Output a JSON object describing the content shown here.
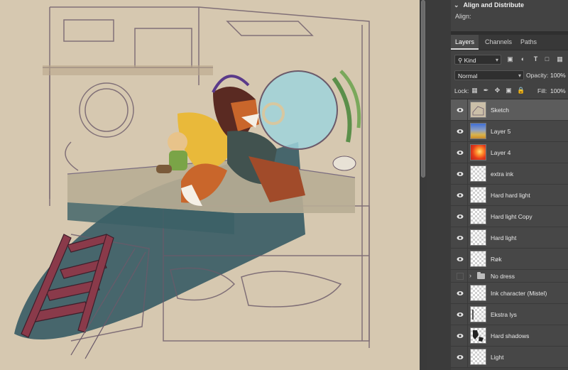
{
  "align_panel": {
    "title": "Align and Distribute",
    "align_label": "Align:"
  },
  "tabs": [
    {
      "label": "Layers",
      "active": true
    },
    {
      "label": "Channels",
      "active": false
    },
    {
      "label": "Paths",
      "active": false
    }
  ],
  "filter": {
    "kind_label": "Kind",
    "icons": [
      "image-filter-icon",
      "adjustment-filter-icon",
      "type-filter-icon",
      "shape-filter-icon",
      "smart-object-filter-icon"
    ]
  },
  "blend": {
    "mode": "Normal",
    "opacity_label": "Opacity:",
    "opacity_value": "100%"
  },
  "lock": {
    "label": "Lock:",
    "icons": [
      "lock-transparent-pixels-icon",
      "lock-image-pixels-icon",
      "lock-position-icon",
      "lock-artboard-icon",
      "lock-all-icon"
    ],
    "fill_label": "Fill:",
    "fill_value": "100%"
  },
  "layers": [
    {
      "name": "Sketch",
      "visible": true,
      "selected": true,
      "thumb": "sketch"
    },
    {
      "name": "Layer 5",
      "visible": true,
      "selected": false,
      "thumb": "layer5"
    },
    {
      "name": "Layer 4",
      "visible": true,
      "selected": false,
      "thumb": "layer4"
    },
    {
      "name": "extra ink",
      "visible": true,
      "selected": false,
      "thumb": "transparent"
    },
    {
      "name": "Hard hard light",
      "visible": true,
      "selected": false,
      "thumb": "transparent"
    },
    {
      "name": "Hard light Copy",
      "visible": true,
      "selected": false,
      "thumb": "transparent"
    },
    {
      "name": "Hard light",
      "visible": true,
      "selected": false,
      "thumb": "transparent"
    },
    {
      "name": "Røk",
      "visible": true,
      "selected": false,
      "thumb": "transparent"
    },
    {
      "name": "No dress",
      "visible": false,
      "selected": false,
      "group": true
    },
    {
      "name": "Ink character (Mistel)",
      "visible": true,
      "selected": false,
      "thumb": "transparent"
    },
    {
      "name": "Ekstra lys",
      "visible": true,
      "selected": false,
      "thumb": "transparent"
    },
    {
      "name": "Hard shadows",
      "visible": true,
      "selected": false,
      "thumb": "transparent"
    },
    {
      "name": "Light",
      "visible": true,
      "selected": false,
      "thumb": "transparent"
    }
  ],
  "colors": {
    "canvas_bg": "#d6c8b0",
    "panel_bg": "#424242",
    "selected_layer": "#5c5c5c"
  }
}
